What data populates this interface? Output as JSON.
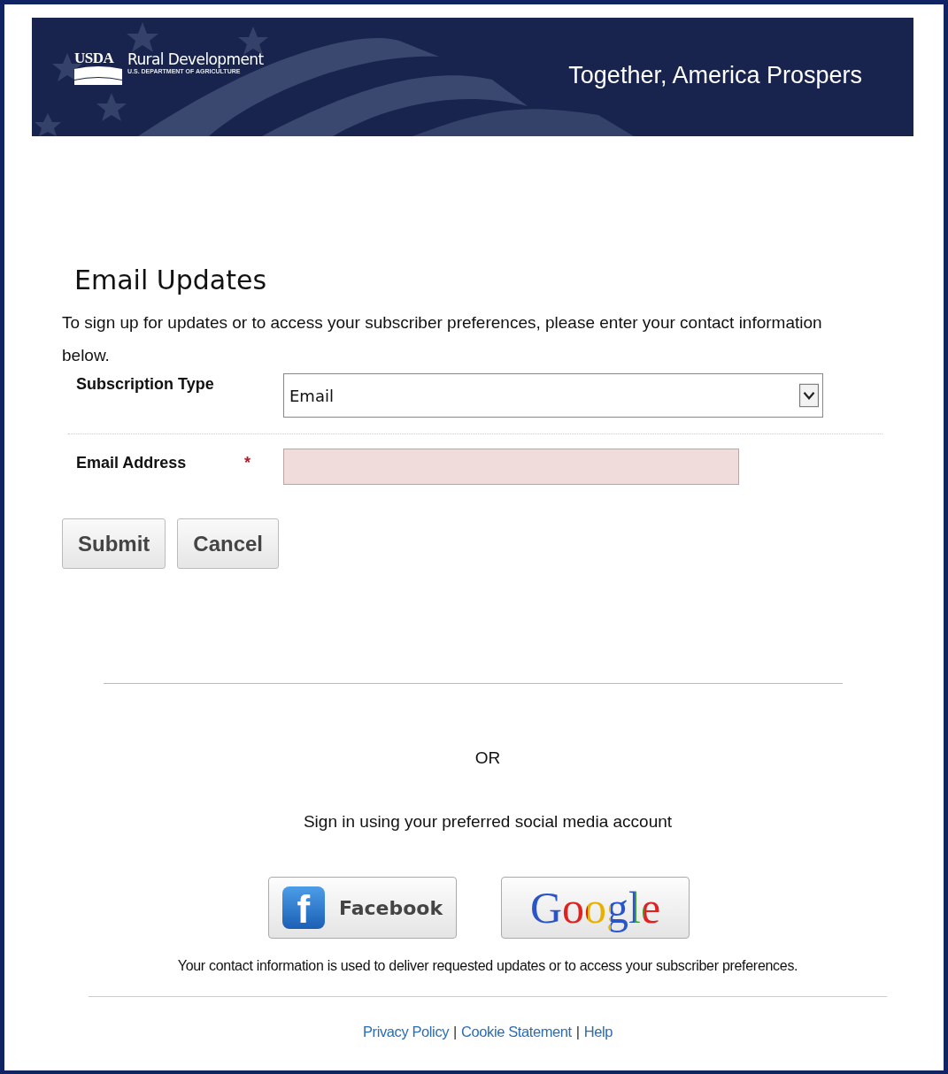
{
  "banner": {
    "logo_mark": "USDA",
    "agency": "Rural Development",
    "department": "U.S. DEPARTMENT OF AGRICULTURE",
    "tagline": "Together, America Prospers"
  },
  "heading": "Email Updates",
  "intro": "To sign up for updates or to access your subscriber preferences, please enter your contact information below.",
  "form": {
    "fields": [
      {
        "kind": "select",
        "label": "Subscription Type",
        "required": false,
        "value": "Email"
      },
      {
        "kind": "text",
        "label": "Email Address",
        "required": true,
        "required_mark": "*",
        "invalid": true
      }
    ],
    "buttons": [
      "Submit",
      "Cancel"
    ]
  },
  "divider_text": "OR",
  "social_prompt": "Sign in using your preferred social media account",
  "social_buttons": [
    {
      "kind": "facebook",
      "label": "Facebook",
      "icon_letter": "f"
    },
    {
      "kind": "google",
      "label": "Google"
    }
  ],
  "disclaimer": "Your contact information is used to deliver requested updates or to access your subscriber preferences.",
  "footer": {
    "separator": "|",
    "links": [
      "Privacy Policy",
      "Cookie Statement",
      "Help"
    ]
  }
}
